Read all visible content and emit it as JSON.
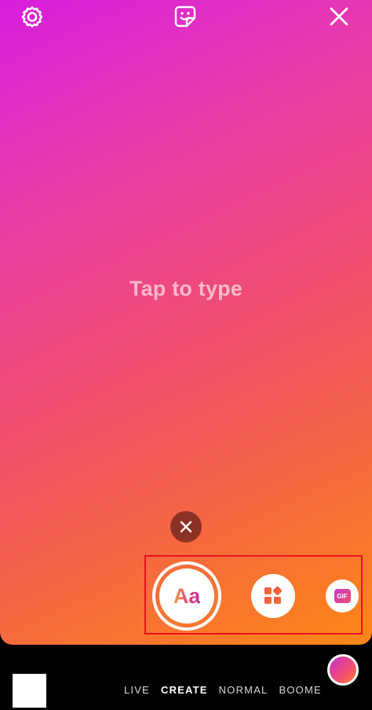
{
  "canvas": {
    "placeholder_text": "Tap to type",
    "gradient_colors": [
      "#d81fe0",
      "#e93ea4",
      "#f0506c",
      "#f66a3d",
      "#ff8716"
    ]
  },
  "top_bar": {
    "left_icon": "settings-icon",
    "center_icon": "sticker-icon",
    "right_icon": "close-icon"
  },
  "tools": {
    "dismiss_icon": "close-icon",
    "text_tool_label": "Aa",
    "layout_tool_icon": "layout-grid-icon",
    "gif_tool_label": "GIF",
    "highlight_color": "#e8141f"
  },
  "bottom_bar": {
    "modes": [
      {
        "label": "LIVE",
        "active": false
      },
      {
        "label": "CREATE",
        "active": true
      },
      {
        "label": "NORMAL",
        "active": false
      },
      {
        "label": "BOOMERANG",
        "active": false
      }
    ],
    "gallery_icon": "gallery-thumbnail",
    "capture_icon": "color-gradient-button"
  }
}
